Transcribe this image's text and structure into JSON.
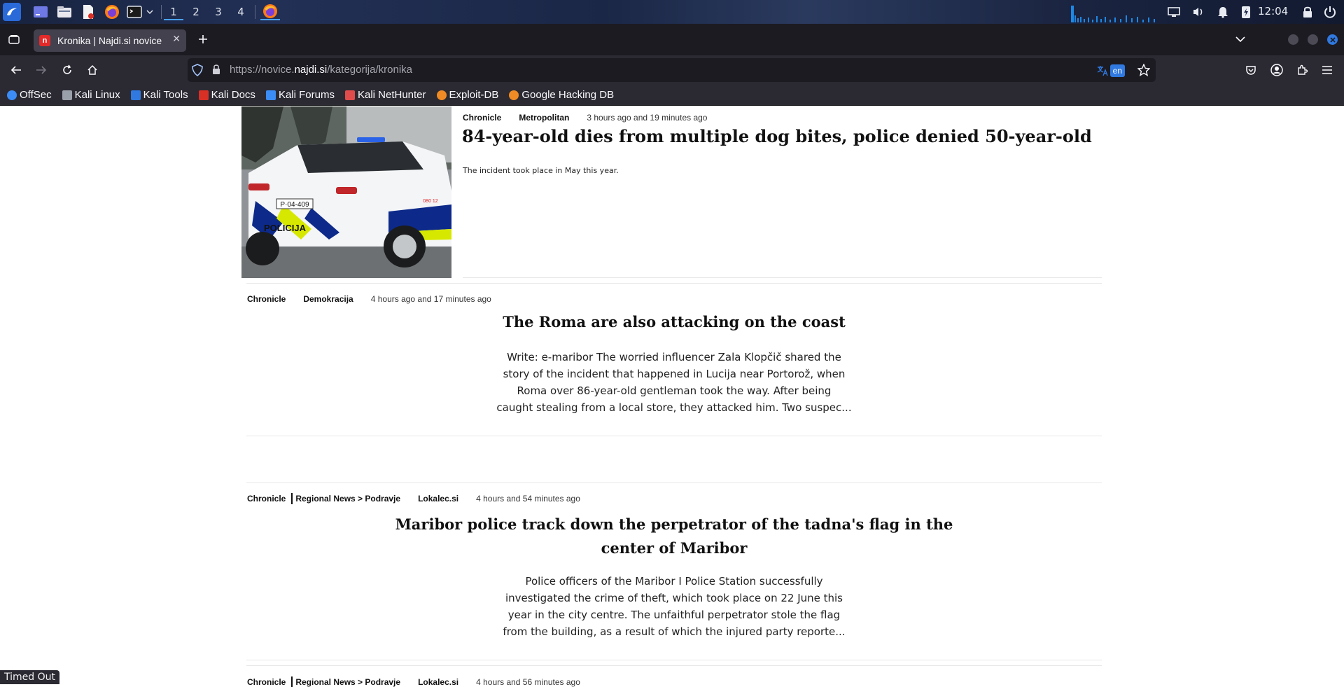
{
  "taskbar": {
    "workspaces": [
      "1",
      "2",
      "3",
      "4"
    ],
    "clock": "12:04",
    "icons": [
      "kali-menu-icon",
      "terminal-window-icon",
      "file-manager-icon",
      "text-editor-icon",
      "firefox-icon",
      "terminal-icon",
      "chevron-down-icon"
    ],
    "accent": "#4aa3ff"
  },
  "browser": {
    "tab": {
      "title": "Kronika | Najdi.si novice",
      "favicon_letter": "n",
      "favicon_color": "#e22a2a"
    },
    "url": {
      "prefix": "https://novice.",
      "host": "najdi.si",
      "path": "/kategorija/kronika"
    },
    "translate_lang": "en",
    "bookmarks": [
      {
        "label": "OffSec",
        "color": "#3b8cf5"
      },
      {
        "label": "Kali Linux",
        "color": "#9aa0aa"
      },
      {
        "label": "Kali Tools",
        "color": "#2f79e0"
      },
      {
        "label": "Kali Docs",
        "color": "#d93025"
      },
      {
        "label": "Kali Forums",
        "color": "#3b8cf5"
      },
      {
        "label": "Kali NetHunter",
        "color": "#e04b4b"
      },
      {
        "label": "Exploit-DB",
        "color": "#f08a24"
      },
      {
        "label": "Google Hacking DB",
        "color": "#f08a24"
      }
    ]
  },
  "articles": [
    {
      "category": "Chronicle",
      "source": "Metropolitan",
      "time": "3 hours ago and 19 minutes ago",
      "title": "84-year-old dies from multiple dog bites, police denied 50-year-old",
      "excerpt": "The incident took place in May this year.",
      "image": {
        "plate": "P·04-409",
        "label": "POLICIJA",
        "phone": "080 12"
      }
    },
    {
      "category": "Chronicle",
      "source": "Demokracija",
      "time": "4 hours ago and 17 minutes ago",
      "title": "The Roma are also attacking on the coast",
      "excerpt_lines": [
        "Write: e-maribor The worried influencer Zala Klopčič shared the",
        "story of the incident that happened in Lucija near Portorož, when",
        "Roma over 86-year-old gentleman took the way. After being",
        "caught stealing from a local store, they attacked him. Two suspec..."
      ]
    },
    {
      "category": "Chronicle",
      "region": "Regional News > Podravje",
      "source": "Lokalec.si",
      "time": "4 hours and 54 minutes ago",
      "title_lines": [
        "Maribor police track down the perpetrator of the tadna's flag in the",
        "center of Maribor"
      ],
      "excerpt_lines": [
        "Police officers of the Maribor I Police Station successfully",
        "investigated the crime of theft, which took place on 22 June this",
        "year in the city centre. The unfaithful perpetrator stole the flag",
        "from the building, as a result of which the injured party reporte..."
      ]
    },
    {
      "category": "Chronicle",
      "region": "Regional News > Podravje",
      "source": "Lokalec.si",
      "time": "4 hours and 56 minutes ago"
    }
  ],
  "status": {
    "text": "Timed Out"
  }
}
